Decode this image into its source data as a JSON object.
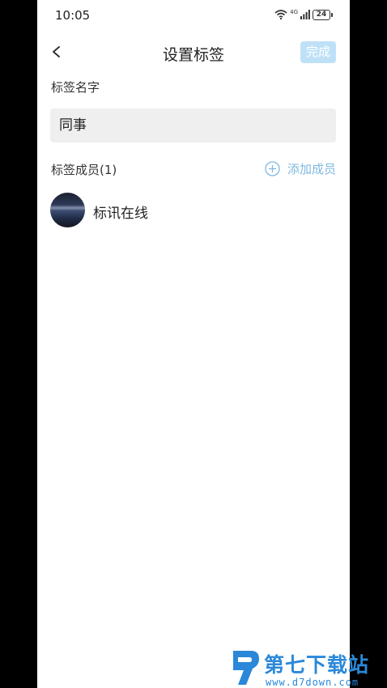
{
  "status_bar": {
    "time": "10:05",
    "network": "4G",
    "battery": "24"
  },
  "nav": {
    "title": "设置标签",
    "done_label": "完成"
  },
  "tag_name": {
    "label": "标签名字",
    "value": "同事"
  },
  "members": {
    "label": "标签成员(1)",
    "add_label": "添加成员",
    "items": [
      {
        "name": "标讯在线"
      }
    ]
  },
  "watermark": {
    "title": "第七下载站",
    "url": "www.d7down.com"
  },
  "colors": {
    "accent": "#7fb9e0",
    "done_bg": "#bfe1f8",
    "input_bg": "#efefef"
  }
}
